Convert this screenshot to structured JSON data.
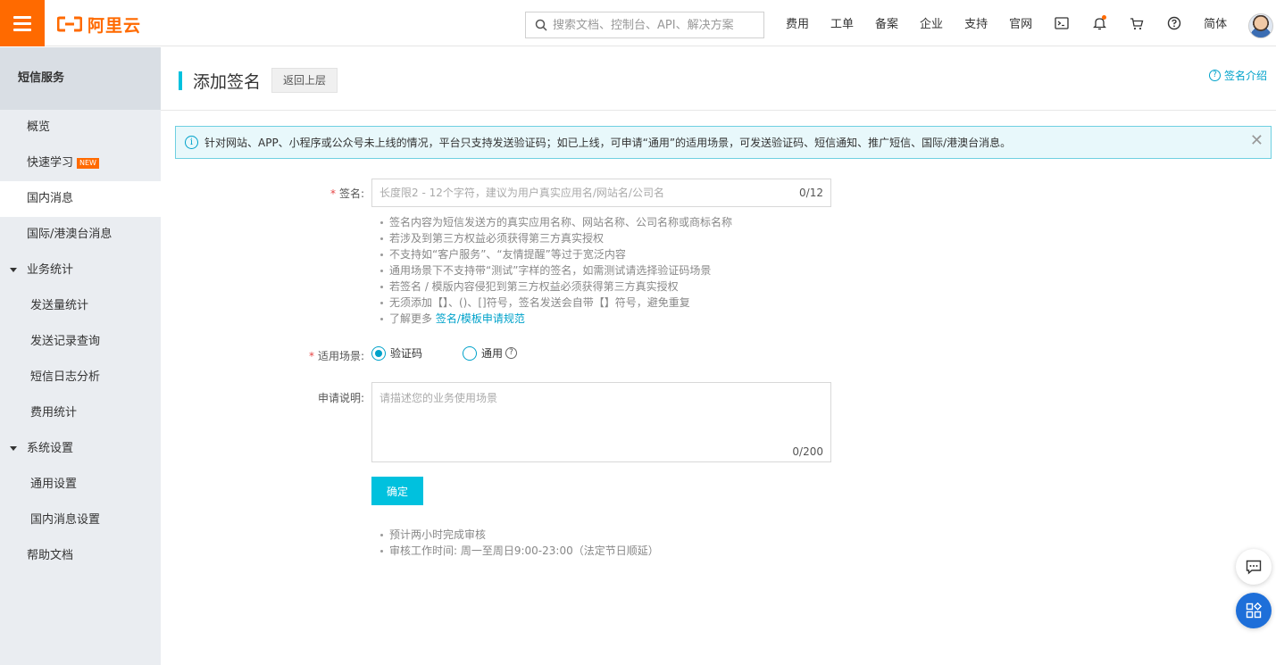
{
  "topbar": {
    "brand": "阿里云",
    "search_placeholder": "搜索文档、控制台、API、解决方案",
    "nav": [
      "费用",
      "工单",
      "备案",
      "企业",
      "支持",
      "官网"
    ],
    "lang": "简体",
    "icons": [
      "terminal-icon",
      "bell-icon",
      "cart-icon",
      "help-icon"
    ],
    "accent": "#ff6a00"
  },
  "sidebar": {
    "title": "短信服务",
    "items": [
      {
        "label": "概览"
      },
      {
        "label": "快速学习",
        "badge": "NEW"
      },
      {
        "label": "国内消息",
        "active": true
      },
      {
        "label": "国际/港澳台消息"
      },
      {
        "label": "业务统计"
      },
      {
        "label": "发送量统计"
      },
      {
        "label": "发送记录查询"
      },
      {
        "label": "短信日志分析"
      },
      {
        "label": "费用统计"
      },
      {
        "label": "系统设置"
      },
      {
        "label": "通用设置"
      },
      {
        "label": "国内消息设置"
      },
      {
        "label": "帮助文档"
      }
    ]
  },
  "page": {
    "title": "添加签名",
    "back": "返回上层",
    "intro_link": "签名介绍",
    "notice": "针对网站、APP、小程序或公众号未上线的情况，平台只支持发送验证码；如已上线，可申请“通用”的适用场景，可发送验证码、短信通知、推广短信、国际/港澳台消息。"
  },
  "form": {
    "signature": {
      "label": "签名:",
      "placeholder": "长度限2 - 12个字符，建议为用户真实应用名/网站名/公司名",
      "counter": "0/12",
      "tips": [
        "签名内容为短信发送方的真实应用名称、网站名称、公司名称或商标名称",
        "若涉及到第三方权益必须获得第三方真实授权",
        "不支持如“客户服务”、“友情提醒”等过于宽泛内容",
        "通用场景下不支持带“测试”字样的签名，如需测试请选择验证码场景",
        "若签名 / 模版内容侵犯到第三方权益必须获得第三方真实授权",
        "无须添加【】、()、[]符号，签名发送会自带【】符号，避免重复",
        "了解更多 "
      ],
      "tips_link": "签名/模板申请规范"
    },
    "scene": {
      "label": "适用场景:",
      "options": [
        "验证码",
        "通用"
      ],
      "selected": "验证码"
    },
    "description": {
      "label": "申请说明:",
      "placeholder": "请描述您的业务使用场景",
      "counter": "0/200"
    },
    "submit": "确定",
    "bottom_tips": [
      "预计两小时完成审核",
      "审核工作时间: 周一至周日9:00-23:00（法定节日顺延）"
    ]
  }
}
